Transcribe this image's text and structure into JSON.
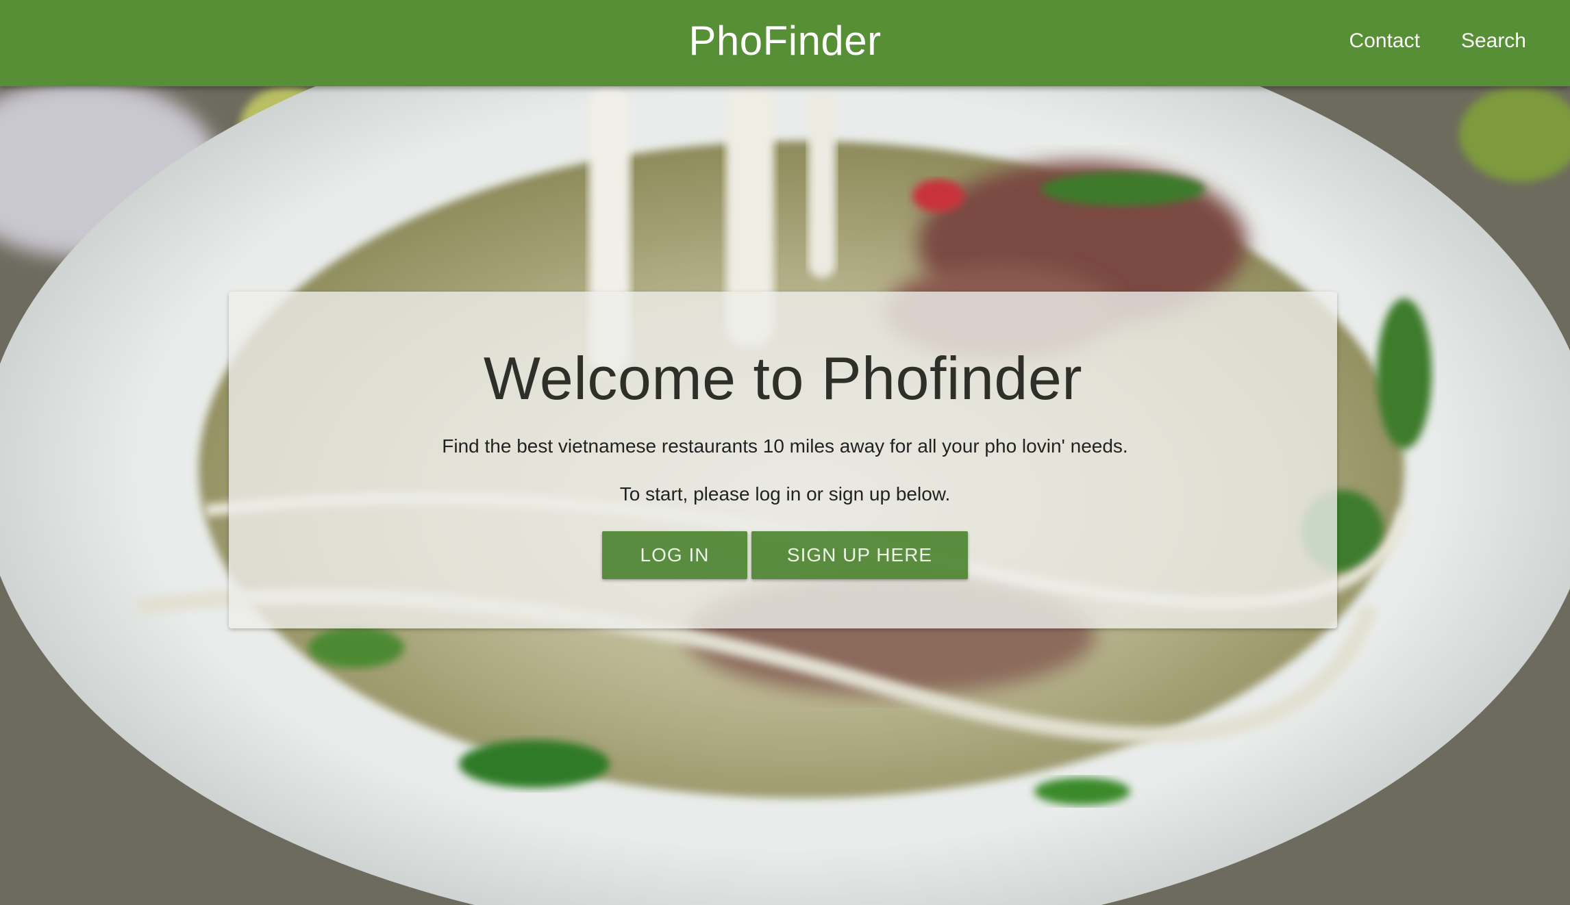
{
  "navbar": {
    "brand": "PhoFinder",
    "links": [
      {
        "label": "Contact"
      },
      {
        "label": "Search"
      }
    ],
    "background_color": "#568f35"
  },
  "hero": {
    "background_image": "pho-bowl-photo"
  },
  "welcome_card": {
    "title": "Welcome to Phofinder",
    "description": "Find the best vietnamese restaurants 10 miles away for all your pho lovin' needs.",
    "instruction": "To start, please log in or sign up below.",
    "login_label": "LOG IN",
    "signup_label": "SIGN UP HERE",
    "button_color": "#4a8129"
  }
}
